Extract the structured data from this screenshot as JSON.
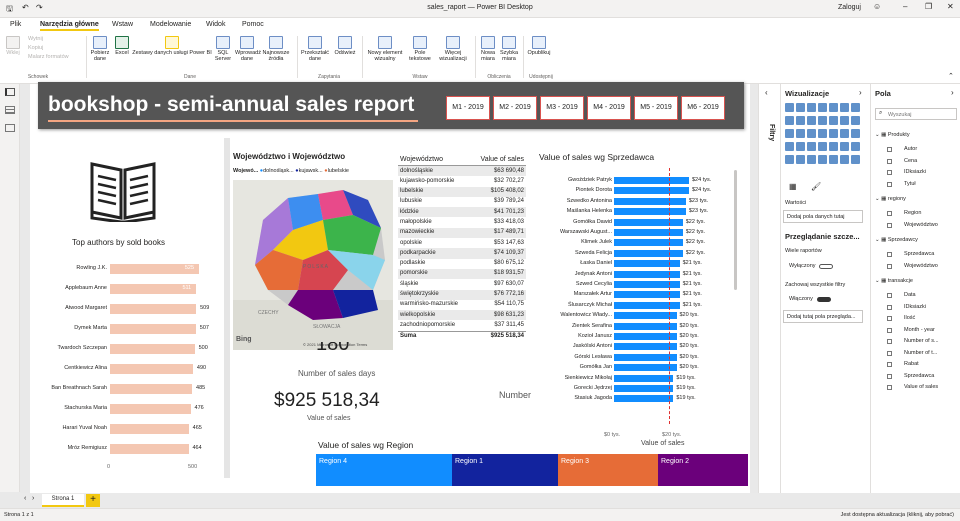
{
  "window": {
    "title": "sales_raport — Power BI Desktop",
    "user": "Zaloguj"
  },
  "menu": [
    "Plik",
    "Narzędzia główne",
    "Wstaw",
    "Modelowanie",
    "Widok",
    "Pomoc"
  ],
  "ribbon": {
    "buttons": [
      {
        "label": "Wklej"
      },
      {
        "label": "Wytnij"
      },
      {
        "label": "Kopiuj"
      },
      {
        "label": "Malarz formatów"
      },
      {
        "label": "Pobierz dane"
      },
      {
        "label": "Excel"
      },
      {
        "label": "Zestawy danych usługi Power BI"
      },
      {
        "label": "SQL Server"
      },
      {
        "label": "Wprowadź dane"
      },
      {
        "label": "Najnowsze źródła"
      },
      {
        "label": "Przekształć dane"
      },
      {
        "label": "Odśwież"
      },
      {
        "label": "Nowy element wizualny"
      },
      {
        "label": "Pole tekstowe"
      },
      {
        "label": "Więcej wizualizacji"
      },
      {
        "label": "Nowa miara"
      },
      {
        "label": "Szybka miara"
      },
      {
        "label": "Opublikuj"
      }
    ],
    "groups": [
      "Schowek",
      "Dane",
      "Zapytania",
      "Wstaw",
      "Obliczenia",
      "Udostępnij"
    ]
  },
  "report": {
    "title": "bookshop - semi-annual sales report",
    "months": [
      "M1 - 2019",
      "M2 - 2019",
      "M3 - 2019",
      "M4 - 2019",
      "M5 - 2019",
      "M6 - 2019"
    ],
    "authors_title": "Top authors by sold books",
    "authors_axis": [
      "0",
      "500"
    ],
    "map_title": "Województwo i Województwo",
    "map_legend": {
      "label": "Wojewó...",
      "items": [
        "dolnośląsk...",
        "kujawsk...",
        "lubelskie"
      ]
    },
    "map_credit": "© 2021 Microsoft Corporation Terms",
    "map_places": [
      "POLSKA",
      "CZECHY",
      "SŁOWACJA"
    ],
    "bing": "Bing",
    "kpi_days": {
      "value": "180",
      "label": "Number of sales days"
    },
    "kpi_sales": {
      "value": "$925 518,34",
      "label": "Value of sales"
    },
    "number_label": "Number ",
    "table": {
      "col1": "Województwo",
      "col2": "Value of sales",
      "total_label": "Suma",
      "total": "$925 518,34"
    },
    "sellers_title": "Value of sales wg Sprzedawca",
    "sellers_axis": [
      "$0 tys.",
      "$20 tys."
    ],
    "sellers_xlabel": "Value of sales",
    "region_title": "Value of sales wg Region"
  },
  "chart_data": [
    {
      "type": "bar",
      "title": "Top authors by sold books",
      "categories": [
        "Rowling J.K.",
        "Applebaum Anne",
        "Atwood Margaret",
        "Dymek Marta",
        "Twardoch Szczepan",
        "Centkiewicz Alina",
        "Ban Breathnach Sarah",
        "Stachurska Maria",
        "Harari Yuval Noah",
        "Mróz Remigiusz"
      ],
      "values": [
        525,
        511,
        509,
        507,
        500,
        490,
        485,
        476,
        465,
        464
      ],
      "xlim": [
        0,
        500
      ]
    },
    {
      "type": "table",
      "title": "Value of sales by Województwo",
      "categories": [
        "dolnośląskie",
        "kujawsko-pomorskie",
        "lubelskie",
        "lubuskie",
        "łódzkie",
        "małopolskie",
        "mazowieckie",
        "opolskie",
        "podkarpackie",
        "podlaskie",
        "pomorskie",
        "śląskie",
        "świętokrzyskie",
        "warmińsko-mazurskie",
        "wielkopolskie",
        "zachodniopomorskie"
      ],
      "values_text": [
        "$63 690,48",
        "$32 702,27",
        "$105 408,02",
        "$39 789,24",
        "$41 701,23",
        "$33 418,03",
        "$17 489,71",
        "$53 147,63",
        "$74 109,37",
        "$80 675,12",
        "$18 931,57",
        "$97 630,07",
        "$76 772,16",
        "$54 110,75",
        "$98 631,23",
        "$37 311,45"
      ]
    },
    {
      "type": "bar",
      "title": "Value of sales wg Sprzedawca",
      "categories": [
        "Gwoździek Patryk",
        "Piontek Dorota",
        "Szwedko Antonina",
        "Maślanka Helenka",
        "Gomółka Dawid",
        "Warszawski August...",
        "Klimek Julek",
        "Szweda Felicja",
        "Łaska Daniel",
        "Jedynak Antoni",
        "Szwed Cecylia",
        "Marszałek Artur",
        "Ślusarczyk Michał",
        "Walentowicz Włady...",
        "Zientek Serafina",
        "Kozioł Janusz",
        "Jaskólski Antoni",
        "Górski Lesława",
        "Gomółka Jan",
        "Sienkiewicz Mikołaj",
        "Gorecki Jędrzej",
        "Stasiuk Jagoda"
      ],
      "values": [
        24,
        24,
        23,
        23,
        22,
        22,
        22,
        22,
        21,
        21,
        21,
        21,
        21,
        20,
        20,
        20,
        20,
        20,
        20,
        19,
        19,
        19
      ],
      "value_labels": [
        "$24 tys.",
        "$24 tys.",
        "$23 tys.",
        "$23 tys.",
        "$22 tys.",
        "$22 tys.",
        "$22 tys.",
        "$22 tys.",
        "$21 tys.",
        "$21 tys.",
        "$21 tys.",
        "$21 tys.",
        "$21 tys.",
        "$20 tys.",
        "$20 tys.",
        "$20 tys.",
        "$20 tys.",
        "$20 tys.",
        "$20 tys.",
        "$19 tys.",
        "$19 tys.",
        "$19 tys."
      ],
      "xlabel": "Value of sales",
      "xlim": [
        0,
        20
      ]
    },
    {
      "type": "bar",
      "title": "Value of sales wg Region",
      "categories": [
        "Region 4",
        "Region 1",
        "Region 3",
        "Region 2"
      ],
      "colors": [
        "#118dff",
        "#12239e",
        "#e66c37",
        "#6b007b"
      ]
    }
  ],
  "viz_pane": {
    "title": "Wizualizacje",
    "values_label": "Wartości",
    "values_placeholder": "Dodaj pola danych tutaj",
    "drill_title": "Przeglądanie szcze...",
    "cross_report": "Wiele raportów",
    "cross_state": "Wyłączony",
    "keep_filters": "Zachowaj wszystkie filtry",
    "keep_state": "Włączony",
    "drill_placeholder": "Dodaj tutaj pola przegląda..."
  },
  "filters_label": "Filtry",
  "fields_pane": {
    "title": "Pola",
    "search_placeholder": "Wyszukaj",
    "tables": [
      {
        "name": "Produkty",
        "fields": [
          "Autor",
          "Cena",
          "IDksiazki",
          "Tytuł"
        ]
      },
      {
        "name": "regiony",
        "fields": [
          "Region",
          "Województwo"
        ]
      },
      {
        "name": "Sprzedawcy",
        "fields": [
          "Sprzedawca",
          "Województwo"
        ]
      },
      {
        "name": "transakcje",
        "fields": [
          "Data",
          "IDksiazki",
          "Ilość",
          "Month - year",
          "Number of s...",
          "Number of t...",
          "Rabat",
          "Sprzedawca",
          "Value of sales"
        ]
      }
    ]
  },
  "page_tab": "Strona 1",
  "status": {
    "left": "Strona 1 z 1",
    "right": "Jest dostępna aktualizacja (kliknij, aby pobrać)"
  }
}
